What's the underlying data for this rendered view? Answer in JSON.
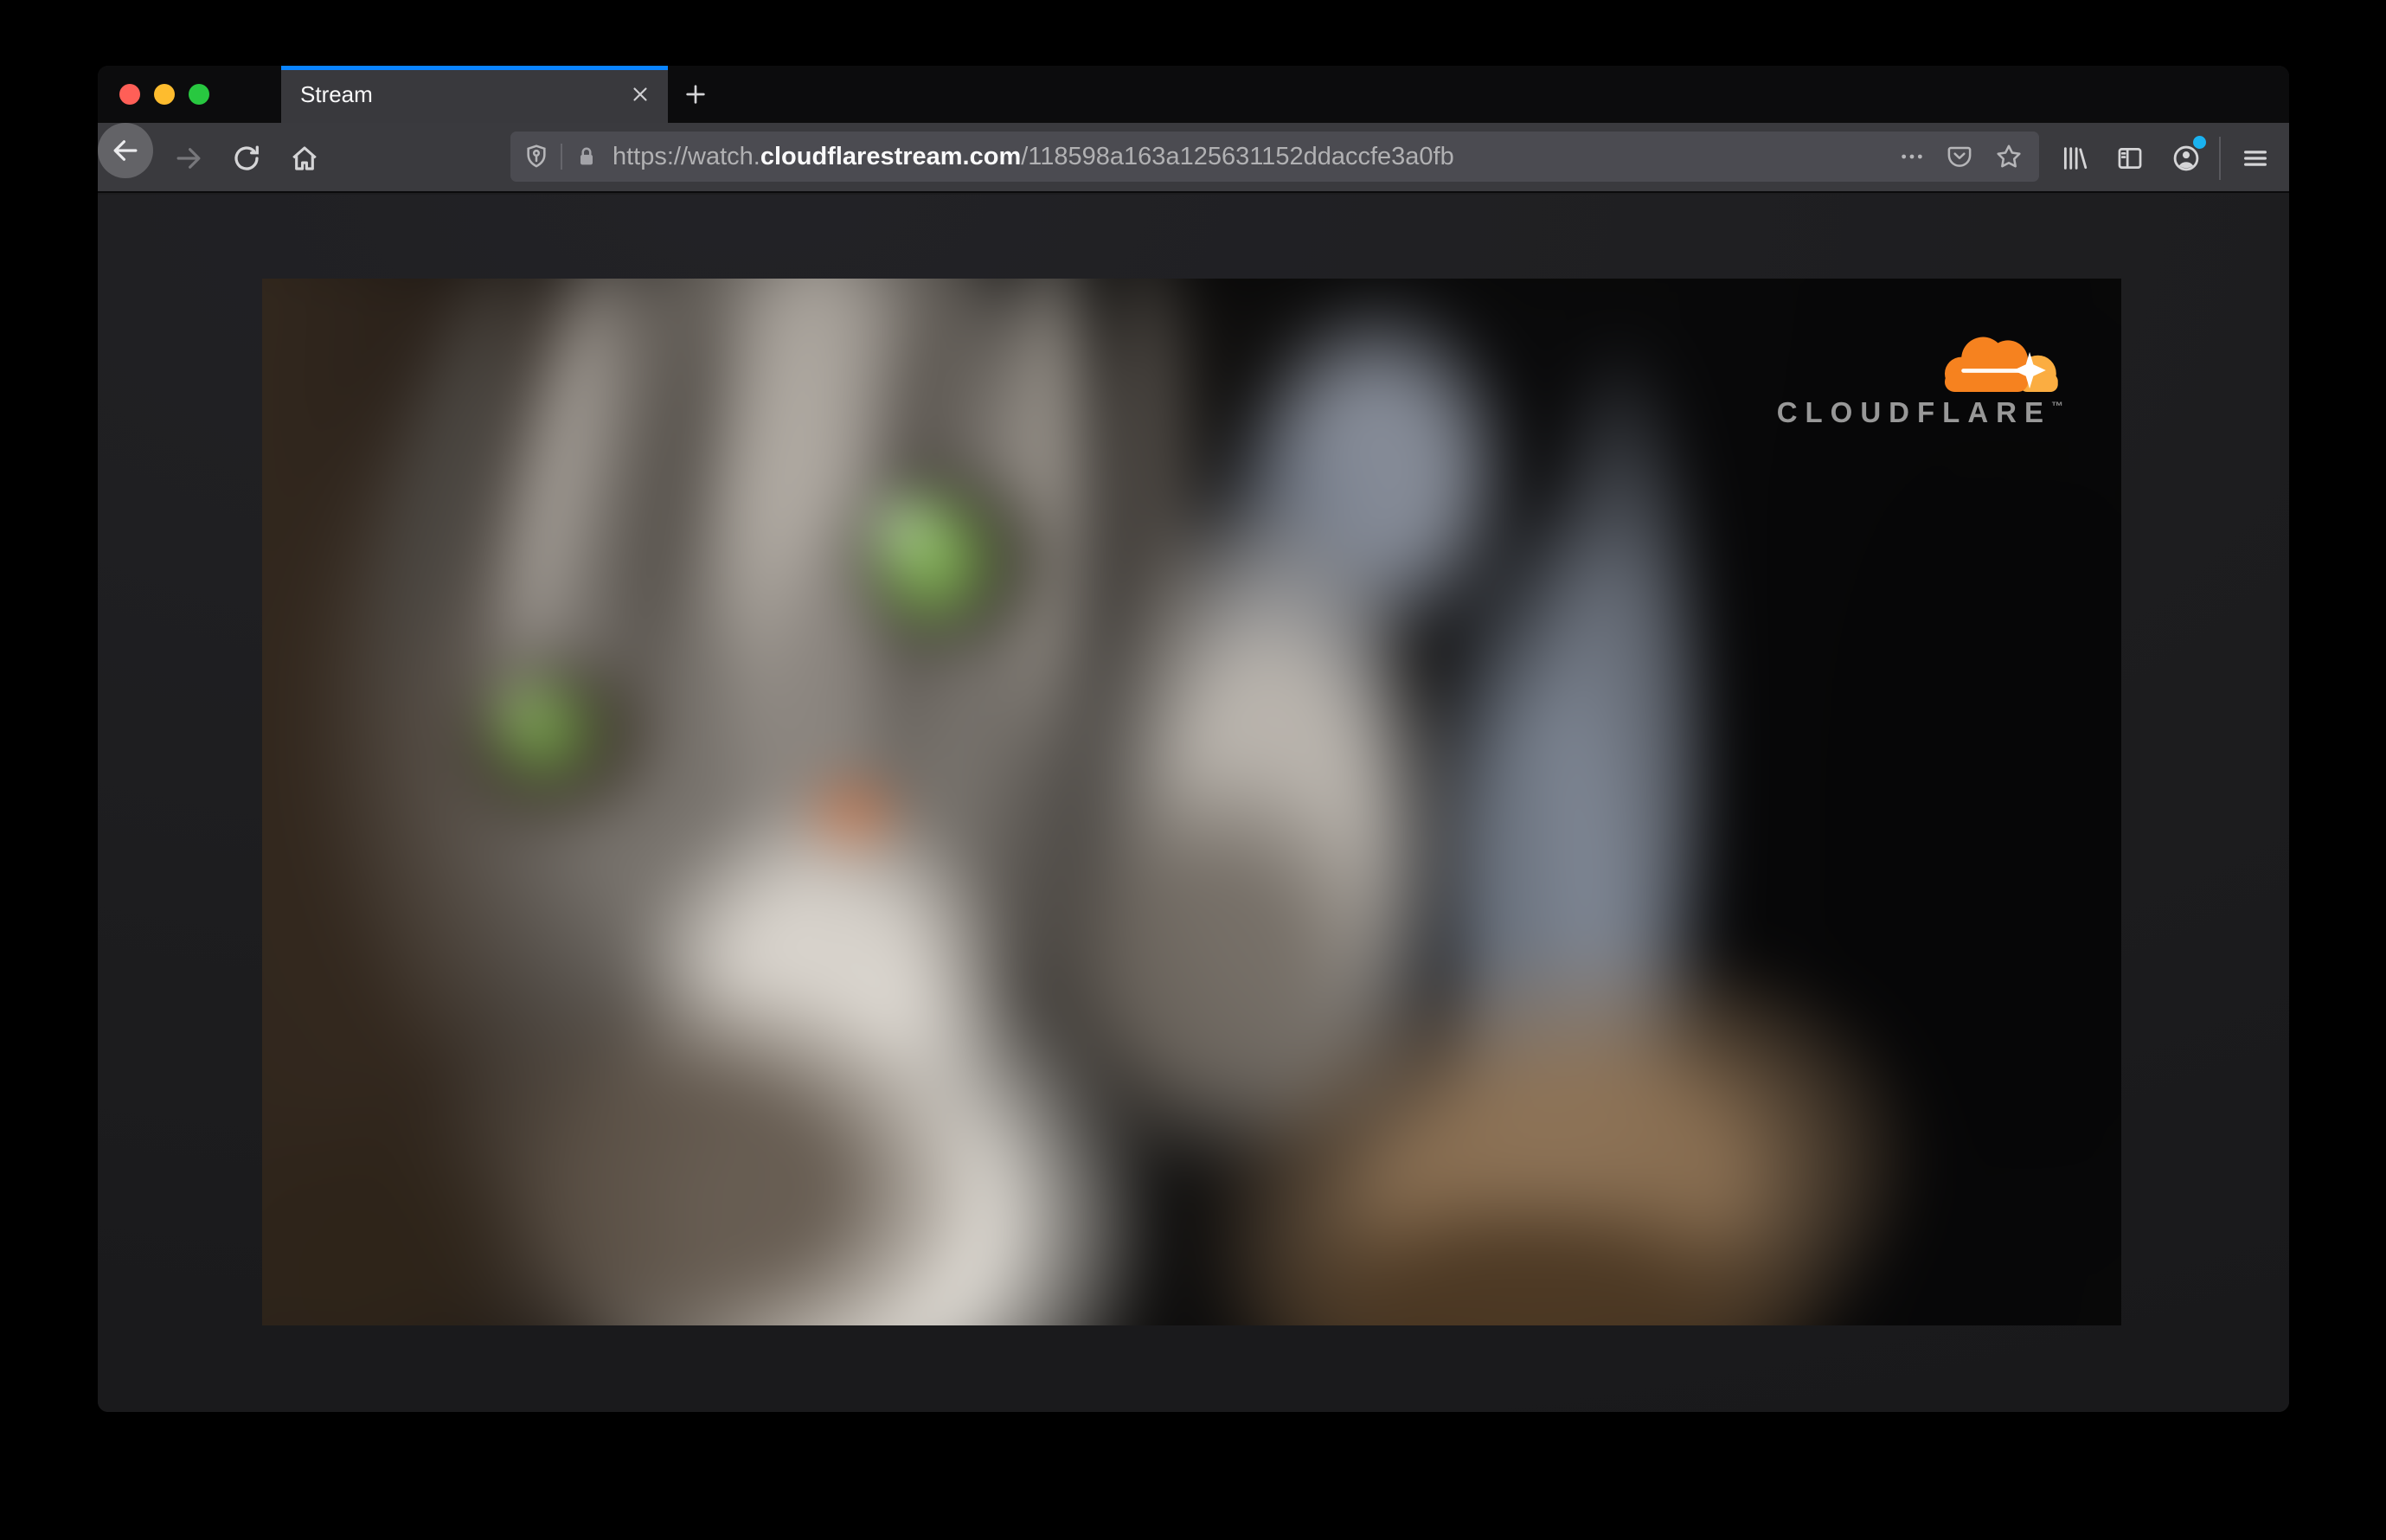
{
  "browser": {
    "tab": {
      "title": "Stream"
    },
    "url": {
      "prefix": "https://watch.",
      "domain": "cloudflarestream.com",
      "path": "/118598a163a125631152ddaccfe3a0fb"
    }
  },
  "video": {
    "brand": "CLOUDFLARE",
    "trademark": "™"
  },
  "icons": {
    "window_controls": [
      "macos-close",
      "macos-minimize",
      "macos-zoom"
    ],
    "tab": [
      "close-x",
      "new-tab-plus"
    ],
    "toolbar_left": [
      "arrow-left-back",
      "arrow-right-forward",
      "reload-circular-arrow",
      "home-house"
    ],
    "urlbar": [
      "tracking-protection-shield",
      "connection-lock",
      "page-actions-ellipsis",
      "pocket-save",
      "bookmark-star"
    ],
    "toolbar_right": [
      "library-books",
      "sidebar-panel",
      "account-person",
      "menu-hamburger"
    ],
    "page": [
      "cloudflare-cloud-logo"
    ]
  },
  "colors": {
    "tab_accent_blue": "#0a84ff",
    "traffic_red": "#ff5f57",
    "traffic_yellow": "#febc2e",
    "traffic_green": "#28c840",
    "notification_blue": "#1ab2f0",
    "cloudflare_orange": "#f6821f",
    "cloudflare_orange_light": "#fbad41",
    "url_dim_text": "#b1b1b3",
    "url_domain_text": "#f9f9fa"
  }
}
